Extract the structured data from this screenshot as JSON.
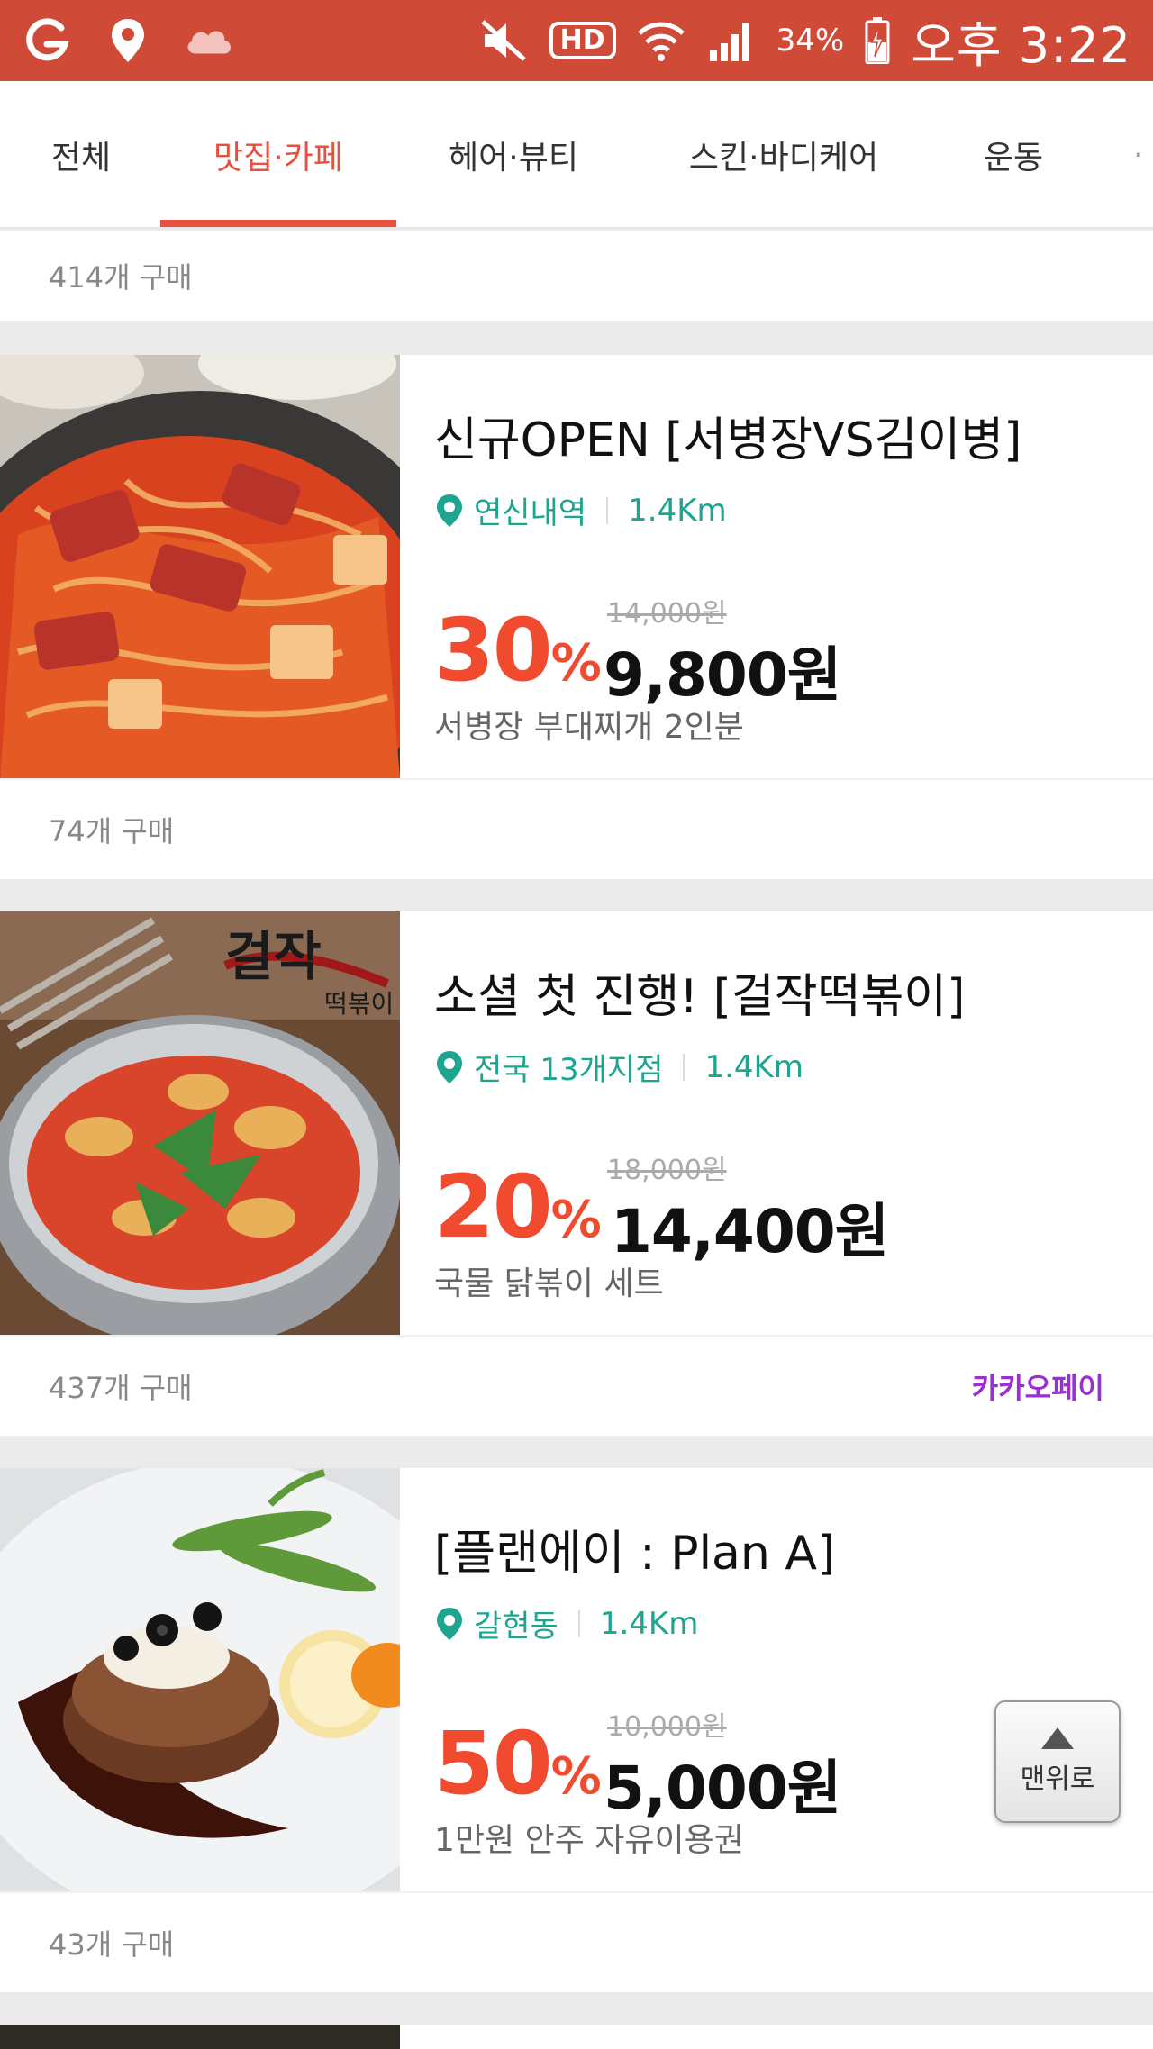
{
  "status_bar": {
    "battery": "34%",
    "time": "오후 3:22",
    "hd": "HD",
    "bg_color": "#d04a38"
  },
  "tabs": [
    {
      "label": "전체",
      "active": false
    },
    {
      "label": "맛집·카페",
      "active": true
    },
    {
      "label": "헤어·뷰티",
      "active": false
    },
    {
      "label": "스킨·바디케어",
      "active": false
    },
    {
      "label": "운동",
      "active": false
    }
  ],
  "accent_color": "#e8513f",
  "top_count": "414개 구매",
  "deals": [
    {
      "title": "신규OPEN [서병장VS김이병]",
      "location": "연신내역",
      "distance": "1.4Km",
      "discount": "30",
      "original_price": "14,000원",
      "price": "9,800원",
      "description": "서병장 부대찌개 2인분",
      "purchase_count": "74개 구매",
      "badge": ""
    },
    {
      "title": "소셜 첫 진행! [걸작떡볶이]",
      "location": "전국 13개지점",
      "distance": "1.4Km",
      "discount": "20",
      "original_price": "18,000원",
      "price": "14,400원",
      "description": "국물 닭볶이 세트",
      "purchase_count": "437개 구매",
      "badge": "카카오페이",
      "image_text": "걸작 떡볶이"
    },
    {
      "title": "[플랜에이 : Plan A]",
      "location": "갈현동",
      "distance": "1.4Km",
      "discount": "50",
      "original_price": "10,000원",
      "price": "5,000원",
      "description": "1만원 안주 자유이용권",
      "purchase_count": "43개 구매",
      "badge": ""
    }
  ],
  "percent_sign": "%",
  "scroll_top_label": "맨위로"
}
